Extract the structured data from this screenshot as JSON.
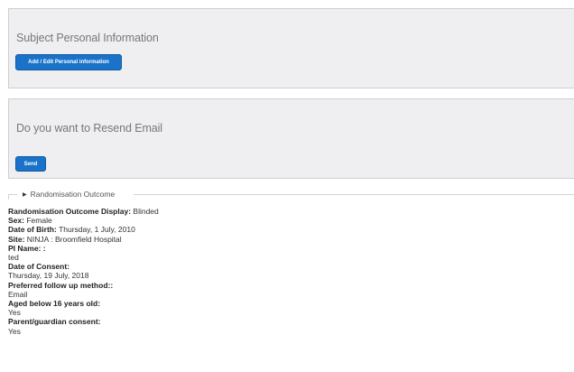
{
  "personal_panel": {
    "title": "Subject Personal Information",
    "button_label": "Add / Edit Personal information"
  },
  "resend_panel": {
    "title": "Do you want to Resend Email",
    "button_label": "Send"
  },
  "randomisation": {
    "legend": "Randomisation Outcome",
    "legend_icon": "triangle-right-icon",
    "outcome_display_label": "Randomisation Outcome Display:",
    "outcome_display_value": "Blinded",
    "sex_label": "Sex:",
    "sex_value": "Female",
    "dob_label": "Date of Birth:",
    "dob_value": "Thursday, 1 July, 2010",
    "site_label": "Site:",
    "site_value": "NINJA : Broomfield Hospital",
    "pi_name_label": "PI Name: :",
    "pi_name_value": "ted",
    "consent_date_label": "Date of Consent:",
    "consent_date_value": "Thursday, 19 July, 2018",
    "followup_label": "Preferred follow up method::",
    "followup_value": "Email",
    "aged_label": "Aged below 16 years old:",
    "aged_value": "Yes",
    "guardian_label": "Parent/guardian consent:",
    "guardian_value": "Yes"
  },
  "colors": {
    "panel_bg": "#efeff1",
    "button_bg": "#1a73c9"
  }
}
